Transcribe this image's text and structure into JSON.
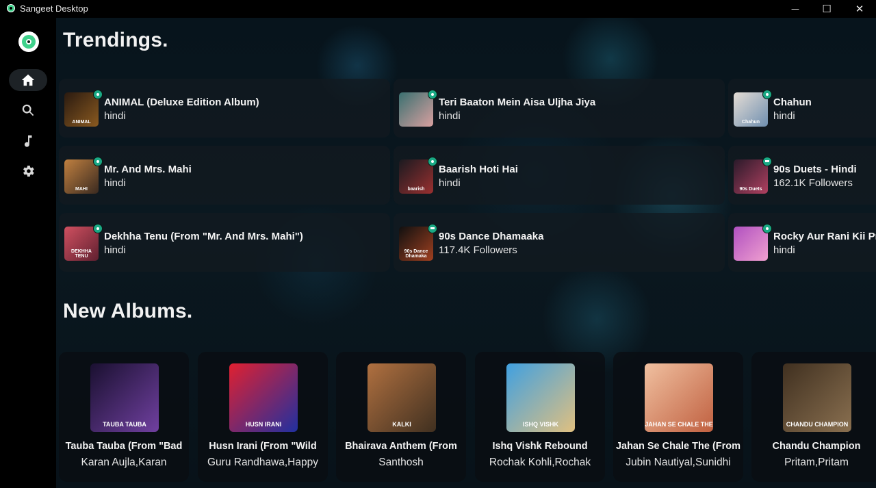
{
  "window": {
    "title": "Sangeet Desktop",
    "minimize_glyph": "—",
    "maximize_glyph": "☐",
    "close_glyph": "✕"
  },
  "sidebar": {
    "items": [
      {
        "name": "home",
        "icon": "home-icon",
        "active": true
      },
      {
        "name": "search",
        "icon": "search-icon",
        "active": false
      },
      {
        "name": "music",
        "icon": "music-note-icon",
        "active": false
      },
      {
        "name": "settings",
        "icon": "gear-icon",
        "active": false
      }
    ]
  },
  "trending": {
    "title": "Trendings.",
    "items": [
      {
        "title": "ANIMAL (Deluxe Edition Album)",
        "subtitle": "hindi",
        "type": "album",
        "art_text": "ANIMAL",
        "colors": [
          "#2a1a10",
          "#8a5a20"
        ]
      },
      {
        "title": "Teri Baaton Mein Aisa Uljha Jiya",
        "subtitle": "hindi",
        "type": "album",
        "art_text": "",
        "colors": [
          "#3a7070",
          "#d9a0a0"
        ]
      },
      {
        "title": "Chahun",
        "subtitle": "hindi",
        "type": "album",
        "art_text": "Chahun",
        "colors": [
          "#e5ddd5",
          "#6f8fb0"
        ]
      },
      {
        "title": "Mr. And Mrs. Mahi",
        "subtitle": "hindi",
        "type": "album",
        "art_text": "MAHI",
        "colors": [
          "#c08040",
          "#3a2a20"
        ]
      },
      {
        "title": "Baarish Hoti Hai",
        "subtitle": "hindi",
        "type": "album",
        "art_text": "baarish",
        "colors": [
          "#1a1a20",
          "#9a3030"
        ]
      },
      {
        "title": "90s Duets - Hindi",
        "subtitle": "162.1K Followers",
        "type": "playlist",
        "art_text": "90s Duets",
        "colors": [
          "#2a1a2a",
          "#b04060"
        ]
      },
      {
        "title": "Dekhha Tenu (From \"Mr. And Mrs. Mahi\")",
        "subtitle": "hindi",
        "type": "album",
        "art_text": "DEKHHA TENU",
        "colors": [
          "#d05060",
          "#602030"
        ]
      },
      {
        "title": "90s Dance Dhamaaka",
        "subtitle": "117.4K Followers",
        "type": "playlist",
        "art_text": "90s Dance Dhamaka",
        "colors": [
          "#101010",
          "#a04020"
        ]
      },
      {
        "title": "Rocky Aur Rani Kii Prem Kahaani",
        "subtitle": "hindi",
        "type": "album",
        "art_text": "",
        "colors": [
          "#b050c0",
          "#f0a0d0"
        ]
      }
    ]
  },
  "new_albums": {
    "title": "New Albums.",
    "items": [
      {
        "title": "Tauba Tauba (From \"Bad",
        "artist": "Karan Aujla,Karan",
        "art_text": "TAUBA TAUBA",
        "colors": [
          "#1a1030",
          "#7040a0"
        ]
      },
      {
        "title": "Husn Irani (From \"Wild",
        "artist": "Guru Randhawa,Happy",
        "art_text": "HUSN IRANI",
        "colors": [
          "#e02030",
          "#2030a0"
        ]
      },
      {
        "title": "Bhairava Anthem (From",
        "artist": "Santhosh",
        "art_text": "KALKI",
        "colors": [
          "#b07040",
          "#403020"
        ]
      },
      {
        "title": "Ishq Vishk Rebound",
        "artist": "Rochak Kohli,Rochak",
        "art_text": "ISHQ VISHK",
        "colors": [
          "#40a0e0",
          "#e0c080"
        ]
      },
      {
        "title": "Jahan Se Chale The (From",
        "artist": "Jubin Nautiyal,Sunidhi",
        "art_text": "JAHAN SE CHALE THE",
        "colors": [
          "#f0c0a0",
          "#c06040"
        ]
      },
      {
        "title": "Chandu Champion",
        "artist": "Pritam,Pritam",
        "art_text": "CHANDU CHAMPION",
        "colors": [
          "#403020",
          "#8a7050"
        ]
      }
    ]
  }
}
